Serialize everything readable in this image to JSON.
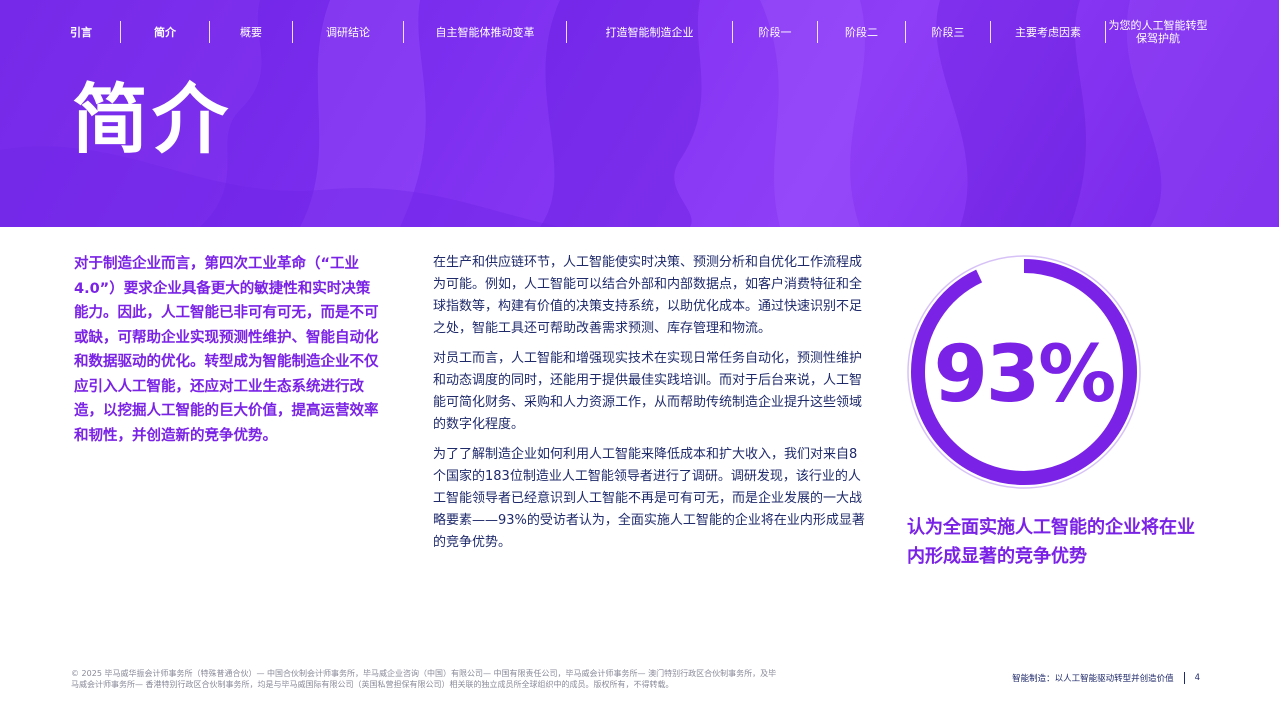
{
  "nav": {
    "items": [
      {
        "label": "引言"
      },
      {
        "label": "简介"
      },
      {
        "label": "概要"
      },
      {
        "label": "调研结论"
      },
      {
        "label": "自主智能体推动变革"
      },
      {
        "label": "打造智能制造企业"
      },
      {
        "label": "阶段一"
      },
      {
        "label": "阶段二"
      },
      {
        "label": "阶段三"
      },
      {
        "label": "主要考虑因素"
      },
      {
        "label": "为您的人工智能转型保驾护航"
      }
    ]
  },
  "hero": {
    "title": "简介"
  },
  "lead_paragraph": "对于制造企业而言，第四次工业革命（“工业4.0”）要求企业具备更大的敏捷性和实时决策能力。因此，人工智能已非可有可无，而是不可或缺，可帮助企业实现预测性维护、智能自动化和数据驱动的优化。转型成为智能制造企业不仅应引入人工智能，还应对工业生态系统进行改造，以挖掘人工智能的巨大价值，提高运营效率和韧性，并创造新的竞争优势。",
  "body": {
    "paragraphs": [
      "在生产和供应链环节，人工智能使实时决策、预测分析和自优化工作流程成为可能。例如，人工智能可以结合外部和内部数据点，如客户消费特征和全球指数等，构建有价值的决策支持系统，以助优化成本。通过快速识别不足之处，智能工具还可帮助改善需求预测、库存管理和物流。",
      "对员工而言，人工智能和增强现实技术在实现日常任务自动化，预测性维护和动态调度的同时，还能用于提供最佳实践培训。而对于后台来说，人工智能可简化财务、采购和人力资源工作，从而帮助传统制造企业提升这些领域的数字化程度。",
      "为了了解制造企业如何利用人工智能来降低成本和扩大收入，我们对来自8个国家的183位制造业人工智能领导者进行了调研。调研发现，该行业的人工智能领导者已经意识到人工智能不再是可有可无，而是企业发展的一大战略要素——93%的受访者认为，全面实施人工智能的企业将在业内形成显著的竞争优势。"
    ]
  },
  "stat": {
    "value": "93%",
    "fraction": 0.93,
    "caption": "认为全面实施人工智能的企业将在业内形成显著的竞争优势",
    "accent_color": "#7a22e6"
  },
  "footer": {
    "legal": "© 2025 毕马威华振会计师事务所（特殊普通合伙）— 中国合伙制会计师事务所，毕马威企业咨询（中国）有限公司— 中国有限责任公司，毕马威会计师事务所— 澳门特别行政区合伙制事务所，及毕马威会计师事务所— 香港特别行政区合伙制事务所，均是与毕马威国际有限公司（英国私营担保有限公司）相关联的独立成员所全球组织中的成员。版权所有，不得转载。",
    "doc_title": "智能制造：以人工智能驱动转型并创造价值",
    "page_number": "4"
  }
}
